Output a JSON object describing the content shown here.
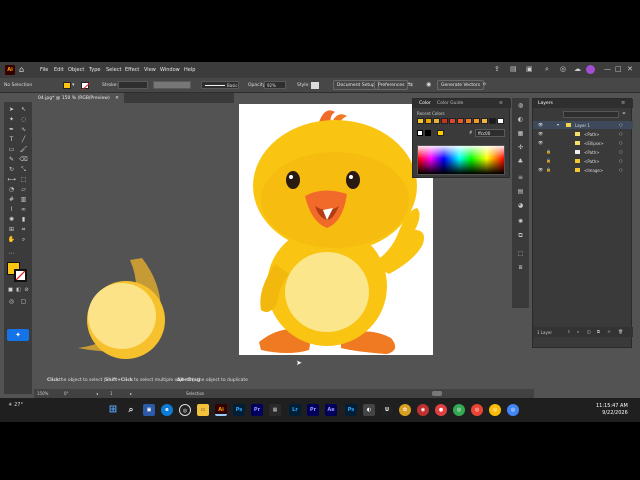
{
  "menubar": {
    "logo": "Ai",
    "items": [
      "File",
      "Edit",
      "Object",
      "Type",
      "Select",
      "Effect",
      "View",
      "Window",
      "Help"
    ]
  },
  "control_bar": {
    "selection_label": "No Selection",
    "stroke_label": "Stroke:",
    "brush_label": "Basic",
    "opacity_label": "Opacity:",
    "opacity_value": "92%",
    "style_label": "Style:",
    "document_setup": "Document Setup",
    "preferences": "Preferences",
    "generate_vectors": "Generate Vectors"
  },
  "document": {
    "tab_title": "04.jpg* @ 150 % (RGB/Preview)"
  },
  "color_panel": {
    "tab_color": "Color",
    "tab_color_guide": "Color Guide",
    "recent_colors_label": "Recent Colors",
    "hex_value": "ffcc00",
    "recent_colors": [
      "#f7c531",
      "#f0a500",
      "#e8b23a",
      "#c8321c",
      "#d9452d",
      "#e35b2a",
      "#eb7d2a",
      "#f19a2b",
      "#f5b33a",
      "#1b1b1b",
      "#ffffff"
    ]
  },
  "layers_panel": {
    "title": "Layers",
    "rows": [
      {
        "name": "Layer 1"
      },
      {
        "name": "<Path>"
      },
      {
        "name": "<Ellipse>"
      },
      {
        "name": "<Path>"
      },
      {
        "name": "<Path>"
      },
      {
        "name": "<Image>"
      }
    ],
    "footer_count": "1 Layer"
  },
  "statusbar": {
    "hint_click": "Click",
    "hint_1": "the object to select |",
    "hint_shift": "Shift+Click",
    "hint_2": "to select multiple objects |",
    "hint_alt": "Alt+Drag",
    "hint_3": "the object to duplicate"
  },
  "bottombar": {
    "zoom": "150%",
    "angle": "0°",
    "artboard_num": "1",
    "tool_name": "Selection"
  },
  "taskbar": {
    "weather_temp": "27°",
    "time": "11:15:47 AM",
    "date": "9/22/2026",
    "apps": [
      {
        "name": "ps-icon",
        "label": "Ps",
        "color": "#001e36",
        "fg": "#31a8ff"
      },
      {
        "name": "pr-icon",
        "label": "Pr",
        "color": "#00005b",
        "fg": "#9999ff"
      },
      {
        "name": "lr-icon",
        "label": "Lr",
        "color": "#001e36",
        "fg": "#31a8ff"
      },
      {
        "name": "pr2-icon",
        "label": "Pr",
        "color": "#00005b",
        "fg": "#9999ff"
      },
      {
        "name": "ae-icon",
        "label": "Ae",
        "color": "#00005b",
        "fg": "#9999ff"
      },
      {
        "name": "ps2-icon",
        "label": "Ps",
        "color": "#001e36",
        "fg": "#31a8ff"
      }
    ]
  },
  "colors": {
    "chick_yellow": "#f9c512",
    "chick_dark": "#e9a20c",
    "belly": "#fce68c",
    "beak": "#f26a2a",
    "feet": "#f07a22",
    "accent_blue": "#1473e6"
  }
}
